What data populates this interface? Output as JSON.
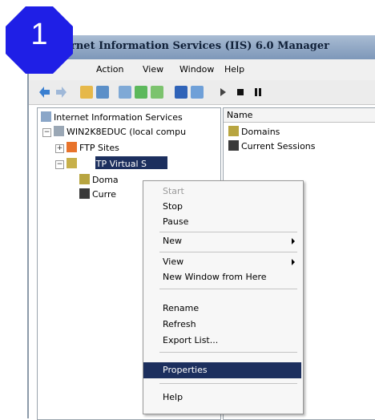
{
  "window": {
    "title": "rnet Information Services (IIS) 6.0 Manager"
  },
  "menubar": {
    "items": [
      "Action",
      "View",
      "Window",
      "Help"
    ]
  },
  "tree": {
    "root": "Internet Information Services",
    "server": "WIN2K8EDUC (local compu",
    "ftp": "FTP Sites",
    "smtp": "[SMTP Virtual S",
    "domains": "Doma",
    "sessions": "Curre"
  },
  "list": {
    "column": "Name",
    "items": [
      "Domains",
      "Current Sessions"
    ]
  },
  "context_menu": {
    "items": [
      {
        "label": "Start",
        "disabled": true
      },
      {
        "label": "Stop"
      },
      {
        "label": "Pause"
      },
      {
        "label": "New",
        "submenu": true
      },
      {
        "label": "View",
        "submenu": true
      },
      {
        "label": "New Window from Here"
      },
      {
        "label": "Rename"
      },
      {
        "label": "Refresh"
      },
      {
        "label": "Export List..."
      },
      {
        "label": "Properties",
        "selected": true
      },
      {
        "label": "Help"
      }
    ]
  },
  "step_badge": {
    "number": "1",
    "color": "#1f1fe6"
  },
  "colors": {
    "selection": "#1c2f5e",
    "title": "#6f8bb0"
  },
  "icons": [
    "back-arrow-icon",
    "forward-arrow-icon",
    "up-folder-icon",
    "show-hide-icon",
    "properties-icon",
    "refresh-icon",
    "export-icon",
    "help-icon",
    "play-icon",
    "stop-icon",
    "pause-icon"
  ]
}
